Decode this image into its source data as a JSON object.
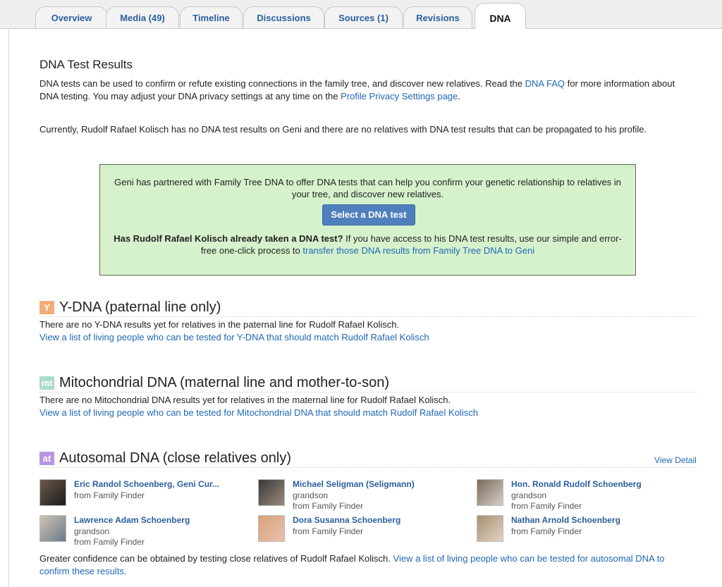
{
  "tabs": [
    {
      "label": "Overview"
    },
    {
      "label": "Media (49)"
    },
    {
      "label": "Timeline"
    },
    {
      "label": "Discussions"
    },
    {
      "label": "Sources (1)"
    },
    {
      "label": "Revisions"
    },
    {
      "label": "DNA",
      "active": true
    }
  ],
  "page": {
    "title": "DNA Test Results",
    "intro_1": "DNA tests can be used to confirm or refute existing connections in the family tree, and discover new relatives. Read the ",
    "intro_link_faq": "DNA FAQ",
    "intro_2": " for more information about DNA testing. You may adjust your DNA privacy settings at any time on the ",
    "intro_link_privacy": "Profile Privacy Settings page",
    "intro_3": ".",
    "status": "Currently, Rudolf Rafael Kolisch has no DNA test results on Geni and there are no relatives with DNA test results that can be propagated to his profile."
  },
  "promo": {
    "text": "Geni has partnered with Family Tree DNA to offer DNA tests that can help you confirm your genetic relationship to relatives in your tree, and discover new relatives.",
    "button": "Select a DNA test",
    "question_bold": "Has Rudolf Rafael Kolisch already taken a DNA test?",
    "question_rest": " If you have access to his DNA test results, use our simple and error-free one-click process to ",
    "transfer_link": "transfer those DNA results from Family Tree DNA to Geni"
  },
  "ydna": {
    "icon_text": "Y",
    "icon_color": "#f3a56b",
    "title": "Y-DNA (paternal line only)",
    "text": "There are no Y-DNA results yet for relatives in the paternal line for Rudolf Rafael Kolisch.",
    "link": "View a list of living people who can be tested for Y-DNA that should match Rudolf Rafael Kolisch"
  },
  "mtdna": {
    "icon_text": "mt",
    "icon_color": "#9fd9c8",
    "title": "Mitochondrial DNA (maternal line and mother-to-son)",
    "text": "There are no Mitochondrial DNA results yet for relatives in the maternal line for Rudolf Rafael Kolisch.",
    "link": "View a list of living people who can be tested for Mitochondrial DNA that should match Rudolf Rafael Kolisch"
  },
  "autosomal": {
    "icon_text": "at",
    "icon_color": "#b18be0",
    "title": "Autosomal DNA (close relatives only)",
    "view_detail": "View Detail",
    "relatives": [
      {
        "name": "Eric Randol Schoenberg, Geni Cur...",
        "lines": [
          "from Family Finder"
        ]
      },
      {
        "name": "Michael Seligman (Seligmann)",
        "lines": [
          "grandson",
          "from Family Finder"
        ]
      },
      {
        "name": "Hon. Ronald Rudolf Schoenberg",
        "lines": [
          "grandson",
          "from Family Finder"
        ]
      },
      {
        "name": "Lawrence Adam Schoenberg",
        "lines": [
          "grandson",
          "from Family Finder"
        ]
      },
      {
        "name": "Dora Susanna Schoenberg",
        "lines": [
          "from Family Finder"
        ]
      },
      {
        "name": "Nathan Arnold Schoenberg",
        "lines": [
          "from Family Finder"
        ]
      }
    ],
    "footer_text": "Greater confidence can be obtained by testing close relatives of Rudolf Rafael Kolisch. ",
    "footer_link": "View a list of living people who can be tested for autosomal DNA to confirm these results."
  }
}
